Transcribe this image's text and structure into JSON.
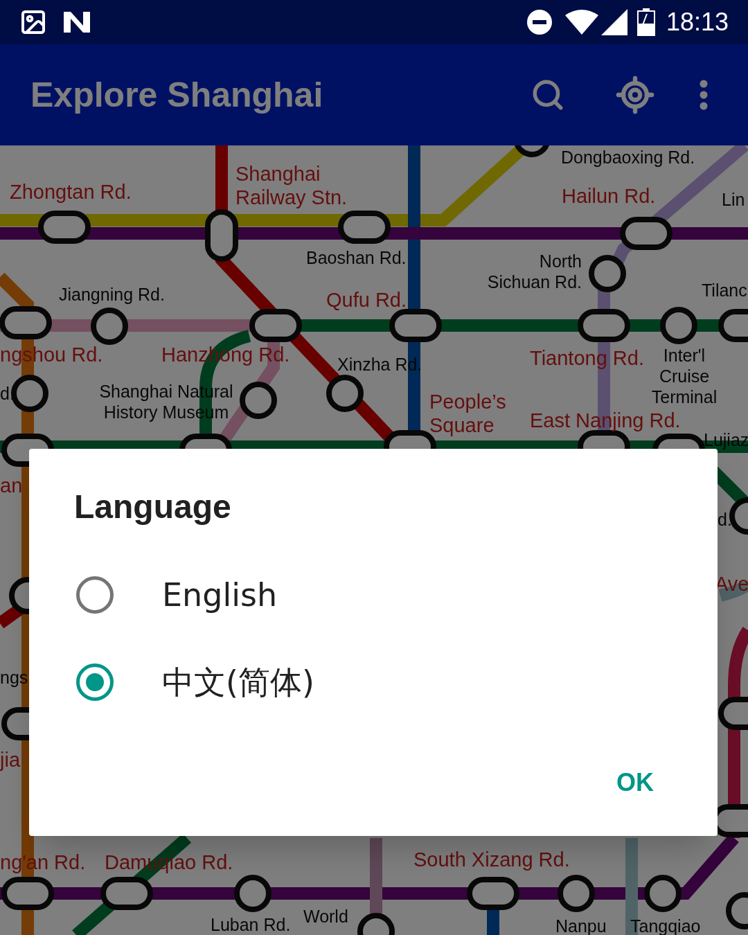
{
  "status_bar": {
    "time": "18:13"
  },
  "app_bar": {
    "title": "Explore Shanghai"
  },
  "map": {
    "labels": [
      {
        "text": "Dongbaoxing Rd.",
        "kind": "station"
      },
      {
        "text": "Zhongtan Rd.",
        "kind": "interchange"
      },
      {
        "text": "Shanghai Railway Stn.",
        "kind": "interchange"
      },
      {
        "text": "Hailun Rd.",
        "kind": "interchange"
      },
      {
        "text": "Lin",
        "kind": "station"
      },
      {
        "text": "Baoshan Rd.",
        "kind": "station"
      },
      {
        "text": "North Sichuan Rd.",
        "kind": "station"
      },
      {
        "text": "Jiangning Rd.",
        "kind": "station"
      },
      {
        "text": "Qufu Rd.",
        "kind": "interchange"
      },
      {
        "text": "Tilanc",
        "kind": "station"
      },
      {
        "text": "ngshou Rd.",
        "kind": "interchange"
      },
      {
        "text": "Hanzhong Rd.",
        "kind": "interchange"
      },
      {
        "text": "Xinzha Rd.",
        "kind": "station"
      },
      {
        "text": "Tiantong Rd.",
        "kind": "interchange"
      },
      {
        "text": "d.",
        "kind": "station"
      },
      {
        "text": "Shanghai Natural History Museum",
        "kind": "station"
      },
      {
        "text": "People’s Square",
        "kind": "interchange"
      },
      {
        "text": "Inter'l Cruise Terminal",
        "kind": "station"
      },
      {
        "text": "East Nanjing Rd.",
        "kind": "interchange"
      },
      {
        "text": "Lujiaz",
        "kind": "station"
      },
      {
        "text": "an",
        "kind": "interchange"
      },
      {
        "text": "d.",
        "kind": "station"
      },
      {
        "text": "Ave",
        "kind": "interchange"
      },
      {
        "text": "ngs",
        "kind": "station"
      },
      {
        "text": "jia",
        "kind": "interchange"
      },
      {
        "text": "ng'an Rd.",
        "kind": "interchange"
      },
      {
        "text": "Damuqiao Rd.",
        "kind": "interchange"
      },
      {
        "text": "South Xizang Rd.",
        "kind": "interchange"
      },
      {
        "text": "Luban Rd.",
        "kind": "station"
      },
      {
        "text": "World",
        "kind": "station"
      },
      {
        "text": "Nanpu",
        "kind": "station"
      },
      {
        "text": "Tangqiao",
        "kind": "station"
      }
    ]
  },
  "dialog": {
    "title": "Language",
    "options": [
      {
        "label": "English",
        "selected": false
      },
      {
        "label": "中文(简体)",
        "selected": true
      }
    ],
    "buttons": [
      "OK"
    ]
  }
}
